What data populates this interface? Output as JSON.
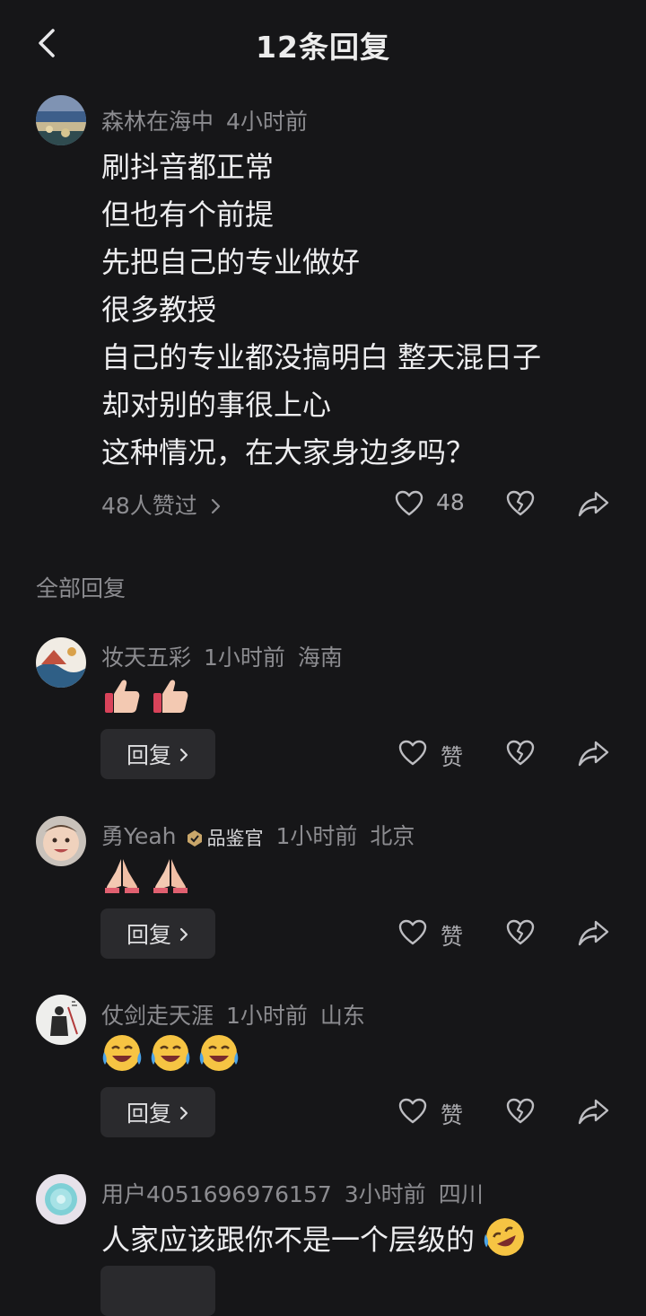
{
  "header": {
    "title": "12条回复"
  },
  "main_comment": {
    "username": "森林在海中",
    "time": "4小时前",
    "lines": [
      "刷抖音都正常",
      "但也有个前提",
      "先把自己的专业做好",
      "很多教授",
      "自己的专业都没搞明白 整天混日子",
      "却对别的事很上心",
      "这种情况，在大家身边多吗？"
    ],
    "likes_summary": "48人赞过",
    "like_count": "48"
  },
  "section_label": "全部回复",
  "replies": [
    {
      "username": "妆天五彩",
      "time": "1小时前",
      "location": "海南",
      "emojis": [
        "thumbs-up",
        "thumbs-up"
      ],
      "reply_label": "回复",
      "like_label": "赞"
    },
    {
      "username": "勇Yeah",
      "badge": "品鉴官",
      "time": "1小时前",
      "location": "北京",
      "emojis": [
        "folded-hands",
        "folded-hands"
      ],
      "reply_label": "回复",
      "like_label": "赞"
    },
    {
      "username": "仗剑走天涯",
      "time": "1小时前",
      "location": "山东",
      "emojis": [
        "laugh-cry",
        "laugh-cry",
        "laugh-cry"
      ],
      "reply_label": "回复",
      "like_label": "赞"
    },
    {
      "username": "用户4051696976157",
      "time": "3小时前",
      "location": "四川",
      "text": "人家应该跟你不是一个层级的",
      "text_emoji": "rolling-laugh"
    }
  ],
  "colors": {
    "background": "#161618",
    "text": "#ededef",
    "meta": "#8c8c90",
    "button": "#2a2a2d"
  }
}
